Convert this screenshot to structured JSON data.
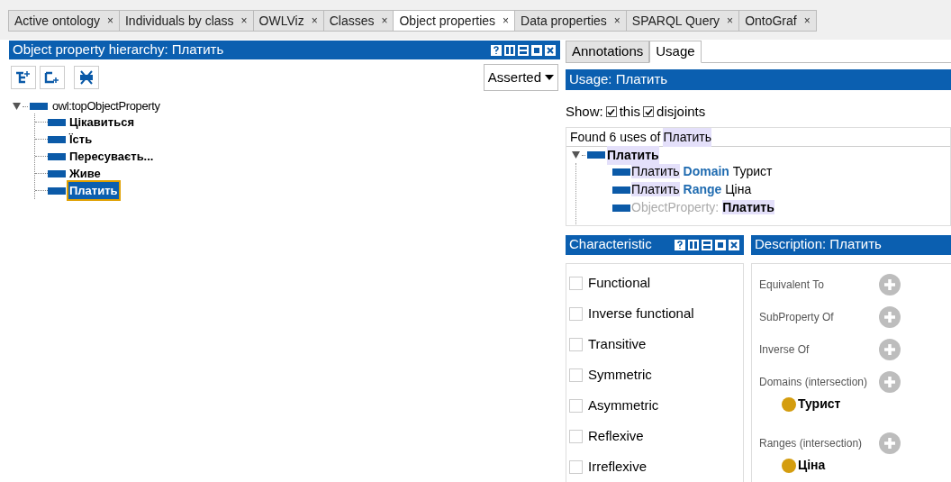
{
  "tabs": [
    {
      "label": "Active ontology",
      "selected": false
    },
    {
      "label": "Individuals by class",
      "selected": false
    },
    {
      "label": "OWLViz",
      "selected": false
    },
    {
      "label": "Classes",
      "selected": false
    },
    {
      "label": "Object properties",
      "selected": true
    },
    {
      "label": "Data properties",
      "selected": false
    },
    {
      "label": "SPARQL Query",
      "selected": false
    },
    {
      "label": "OntoGraf",
      "selected": false
    }
  ],
  "tab_close": "×",
  "hierarchy": {
    "title": "Object property hierarchy: Платить",
    "mode": "Asserted",
    "tree": {
      "label": "owl:topObjectProperty",
      "expanded": true,
      "selected": false,
      "children": [
        {
          "label": "Цікавиться",
          "selected": false
        },
        {
          "label": "Їсть",
          "selected": false
        },
        {
          "label": "Пересуваєть...",
          "selected": false
        },
        {
          "label": "Живе",
          "selected": false
        },
        {
          "label": "Платить",
          "selected": true
        }
      ]
    }
  },
  "right_tabs": [
    {
      "label": "Annotations",
      "selected": false
    },
    {
      "label": "Usage",
      "selected": true
    }
  ],
  "usage": {
    "title": "Usage: Платить",
    "show_label": "Show:",
    "options": [
      {
        "label": "this",
        "checked": true
      },
      {
        "label": "disjoints",
        "checked": true
      }
    ],
    "found_prefix": "Found 6 uses of",
    "found_name": "Платить",
    "root": {
      "label": "Платить",
      "expanded": true
    },
    "uses": [
      {
        "kind": "axiom",
        "subject": "Платить",
        "keyword": "Domain",
        "object": "Турист"
      },
      {
        "kind": "axiom",
        "subject": "Платить",
        "keyword": "Range",
        "object": "Ціна"
      },
      {
        "kind": "declaration",
        "keyword": "ObjectProperty:",
        "subject": "Платить"
      }
    ]
  },
  "characteristics": {
    "title": "Characteristic",
    "items": [
      {
        "label": "Functional",
        "checked": false
      },
      {
        "label": "Inverse functional",
        "checked": false
      },
      {
        "label": "Transitive",
        "checked": false
      },
      {
        "label": "Symmetric",
        "checked": false
      },
      {
        "label": "Asymmetric",
        "checked": false
      },
      {
        "label": "Reflexive",
        "checked": false
      },
      {
        "label": "Irreflexive",
        "checked": false
      }
    ]
  },
  "description": {
    "title": "Description: Платить",
    "sections": [
      {
        "label": "Equivalent To"
      },
      {
        "label": "SubProperty Of"
      },
      {
        "label": "Inverse Of"
      },
      {
        "label": "Domains (intersection)",
        "items": [
          "Турист"
        ]
      },
      {
        "label": "Ranges (intersection)",
        "items": [
          "Ціна"
        ]
      }
    ]
  }
}
